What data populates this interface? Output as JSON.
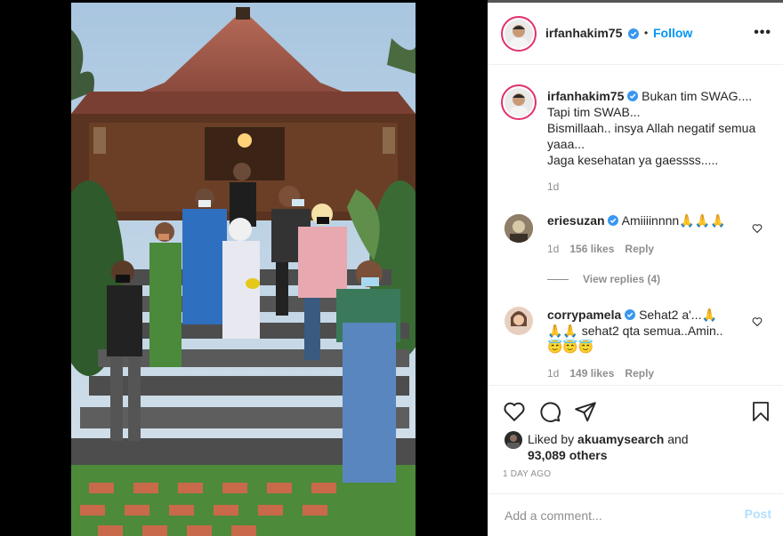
{
  "post": {
    "author": "irfanhakim75",
    "follow_label": "Follow",
    "separator": "•",
    "more_label": "•••",
    "caption_lines": [
      "Bukan tim SWAG....",
      "Tapi tim SWAB...",
      "Bismillaah.. insya Allah negatif semua",
      "yaaa...",
      "Jaga kesehatan ya gaessss....."
    ],
    "caption_time": "1d"
  },
  "comments": [
    {
      "user": "eriesuzan",
      "text": "Amiiiinnnn🙏🙏🙏",
      "time": "1d",
      "likes": "156 likes",
      "reply_label": "Reply",
      "view_replies": "View replies (4)"
    },
    {
      "user": "corrypamela",
      "text": "Sehat2 a'...🙏",
      "text_line2": "🙏🙏 sehat2 qta semua..Amin..",
      "text_line3": "😇😇😇",
      "time": "1d",
      "likes": "149 likes",
      "reply_label": "Reply"
    }
  ],
  "likes": {
    "prefix": "Liked by",
    "user": "akuamysearch",
    "and": "and",
    "others": "93,089 others"
  },
  "timestamp": "1 DAY AGO",
  "add_comment": {
    "placeholder": "Add a comment...",
    "post_label": "Post"
  },
  "colors": {
    "accent": "#0095f6",
    "post_disabled": "#b2dffc",
    "verified": "#3897f0",
    "meta_gray": "#8e8e8e"
  }
}
